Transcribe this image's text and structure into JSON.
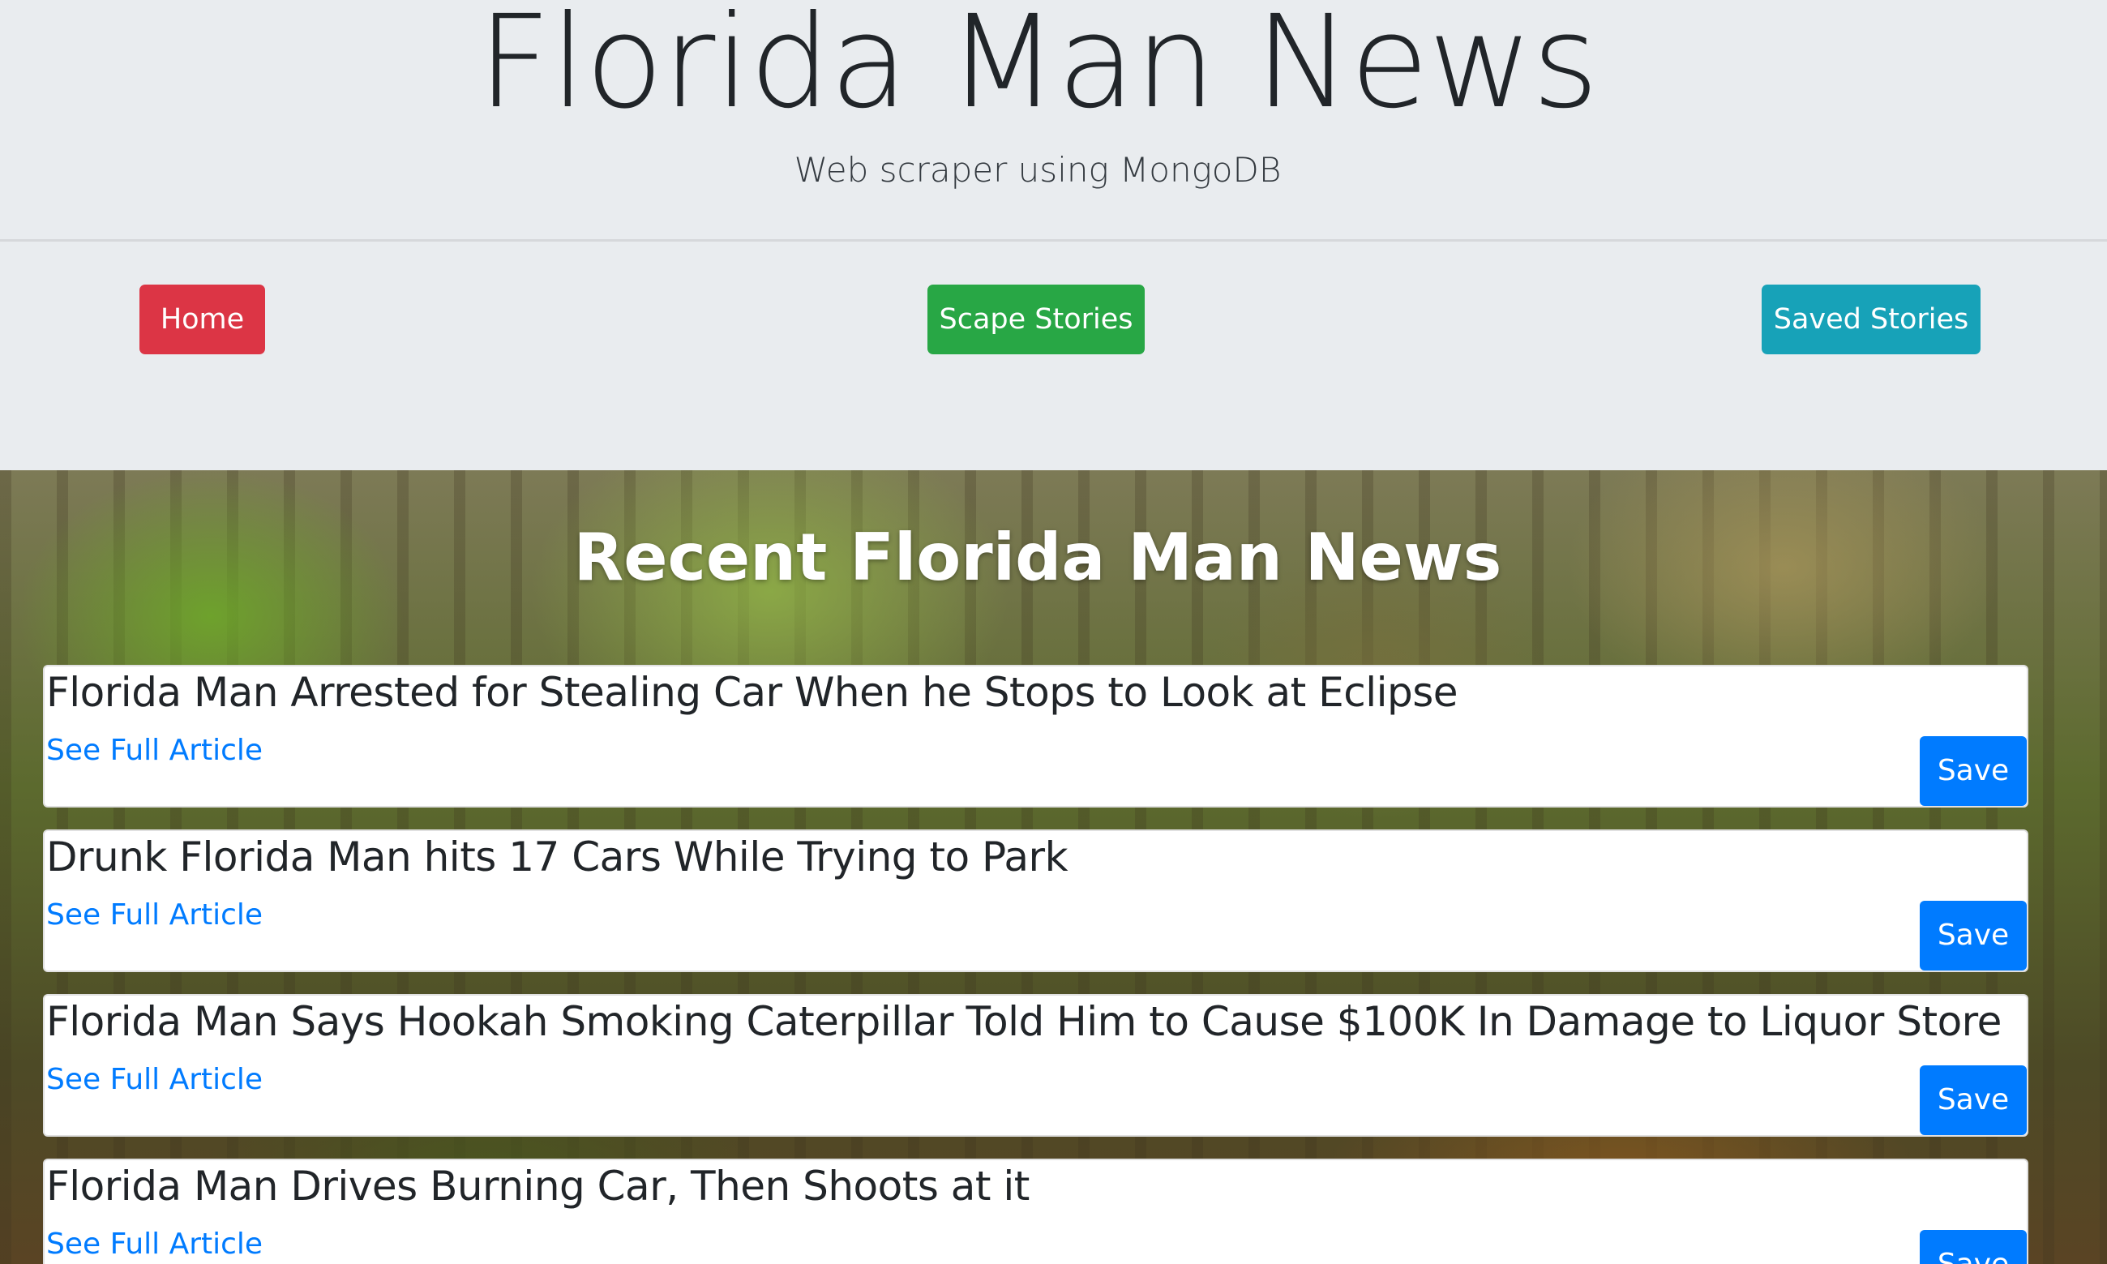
{
  "header": {
    "title": "Florida Man News",
    "subtitle": "Web scraper using MongoDB"
  },
  "nav": {
    "home_label": "Home",
    "scrape_label": "Scape Stories",
    "saved_label": "Saved Stories"
  },
  "main": {
    "section_title": "Recent Florida Man News",
    "articles": [
      {
        "title": "Florida Man Arrested for Stealing Car When he Stops to Look at Eclipse",
        "link_label": "See Full Article",
        "save_label": "Save"
      },
      {
        "title": "Drunk Florida Man hits 17 Cars While Trying to Park",
        "link_label": "See Full Article",
        "save_label": "Save"
      },
      {
        "title": "Florida Man Says Hookah Smoking Caterpillar Told Him to Cause $100K In Damage to Liquor Store",
        "link_label": "See Full Article",
        "save_label": "Save"
      },
      {
        "title": "Florida Man Drives Burning Car, Then Shoots at it",
        "link_label": "See Full Article",
        "save_label": "Save"
      }
    ]
  },
  "colors": {
    "home_button": "#dc3545",
    "scrape_button": "#28a745",
    "saved_button": "#17a2b8",
    "save_button": "#007bff",
    "link": "#007bff",
    "header_background": "#e9ecef"
  }
}
